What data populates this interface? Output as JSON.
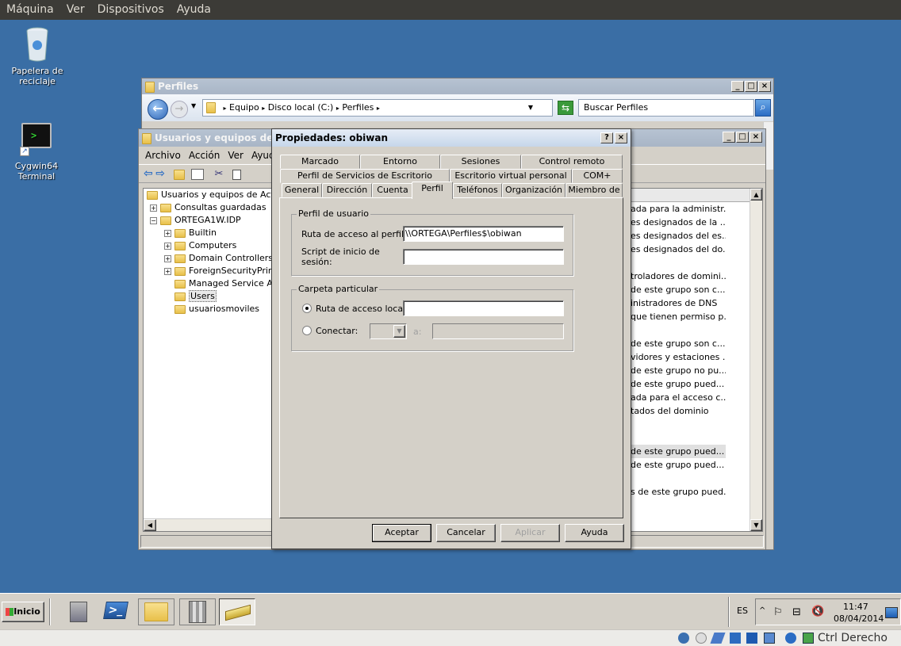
{
  "host_menu": [
    "Máquina",
    "Ver",
    "Dispositivos",
    "Ayuda"
  ],
  "desktop_icons": {
    "recycle": "Papelera de reciclaje",
    "cygwin": "Cygwin64 Terminal"
  },
  "explorer": {
    "title": "Perfiles",
    "breadcrumb": [
      "Equipo",
      "Disco local (C:)",
      "Perfiles"
    ],
    "search_placeholder": "Buscar Perfiles"
  },
  "aduc": {
    "title": "Usuarios y equipos de Active Directory",
    "menu": [
      "Archivo",
      "Acción",
      "Ver",
      "Ayuda"
    ],
    "tree": [
      {
        "label": "Usuarios y equipos de Active",
        "level": 0,
        "expander": ""
      },
      {
        "label": "Consultas guardadas",
        "level": 1,
        "expander": "+"
      },
      {
        "label": "ORTEGA1W.IDP",
        "level": 1,
        "expander": "-"
      },
      {
        "label": "Builtin",
        "level": 2,
        "expander": "+"
      },
      {
        "label": "Computers",
        "level": 2,
        "expander": "+"
      },
      {
        "label": "Domain Controllers",
        "level": 2,
        "expander": "+"
      },
      {
        "label": "ForeignSecurityPrinci",
        "level": 2,
        "expander": "+"
      },
      {
        "label": "Managed Service Acc",
        "level": 2,
        "expander": ""
      },
      {
        "label": "Users",
        "level": 2,
        "expander": "",
        "selected": true
      },
      {
        "label": "usuariosmoviles",
        "level": 2,
        "expander": ""
      }
    ],
    "descriptions": [
      "ada para la administr...",
      "es designados de la ...",
      "es designados del es...",
      "es designados del do...",
      "",
      "troladores de domini...",
      "de este grupo son c...",
      "inistradores de DNS",
      "que tienen permiso p...",
      "",
      "de este grupo son c...",
      "vidores y estaciones ...",
      "de este grupo no pu...",
      "de este grupo pued...",
      "ada para el acceso c...",
      "tados del dominio",
      "",
      "",
      "de este grupo pued...",
      "de este grupo pued...",
      "",
      "s de este grupo pued..."
    ]
  },
  "dialog": {
    "title": "Propiedades: obiwan",
    "help_btn": "?",
    "close_btn": "×",
    "tabs_row1": [
      "Marcado",
      "Entorno",
      "Sesiones",
      "Control remoto"
    ],
    "tabs_row2": [
      "Perfil de Servicios de Escritorio remoto",
      "Escritorio virtual personal",
      "COM+"
    ],
    "tabs_row3": [
      "General",
      "Dirección",
      "Cuenta",
      "Perfil",
      "Teléfonos",
      "Organización",
      "Miembro de"
    ],
    "active_tab": "Perfil",
    "profile_group": "Perfil de usuario",
    "profile_path_label": "Ruta de acceso al perfil:",
    "profile_path_value": "\\\\ORTEGA\\Perfiles$\\obiwan",
    "logon_script_label": "Script de inicio de sesión:",
    "logon_script_value": "",
    "home_group": "Carpeta particular",
    "local_path_label": "Ruta de acceso local:",
    "local_path_value": "",
    "connect_label": "Conectar:",
    "to_label": "a:",
    "buttons": {
      "ok": "Aceptar",
      "cancel": "Cancelar",
      "apply": "Aplicar",
      "help": "Ayuda"
    }
  },
  "taskbar": {
    "start": "Inicio",
    "lang": "ES",
    "time": "11:47",
    "date": "08/04/2014"
  },
  "host_status": {
    "hotkey": "Ctrl Derecho"
  }
}
